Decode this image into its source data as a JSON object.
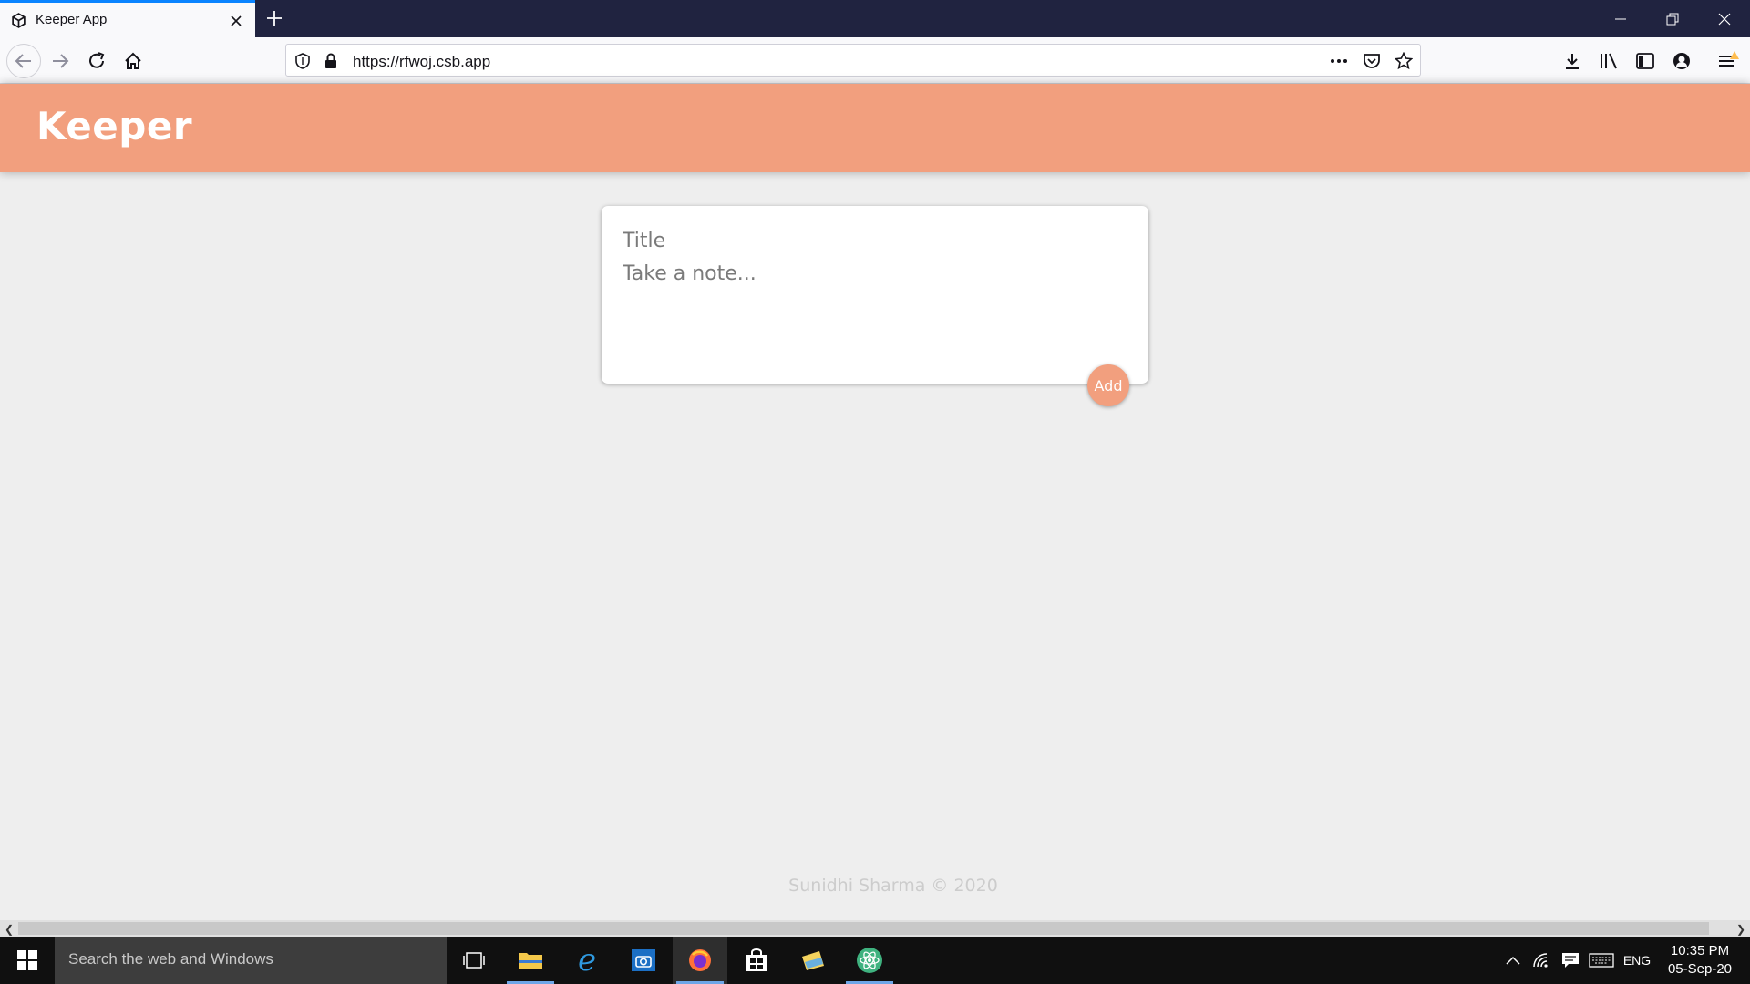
{
  "browser": {
    "tab_title": "Keeper App",
    "url": "https://rfwoj.csb.app"
  },
  "app": {
    "logo": "Keeper",
    "title_placeholder": "Title",
    "note_placeholder": "Take a note...",
    "add_label": "Add",
    "footer": "Sunidhi Sharma © 2020",
    "colors": {
      "accent": "#f29f7e",
      "background": "#eeeeee"
    }
  },
  "taskbar": {
    "search_placeholder": "Search the web and Windows",
    "language": "ENG",
    "time": "10:35 PM",
    "date": "05-Sep-20"
  }
}
